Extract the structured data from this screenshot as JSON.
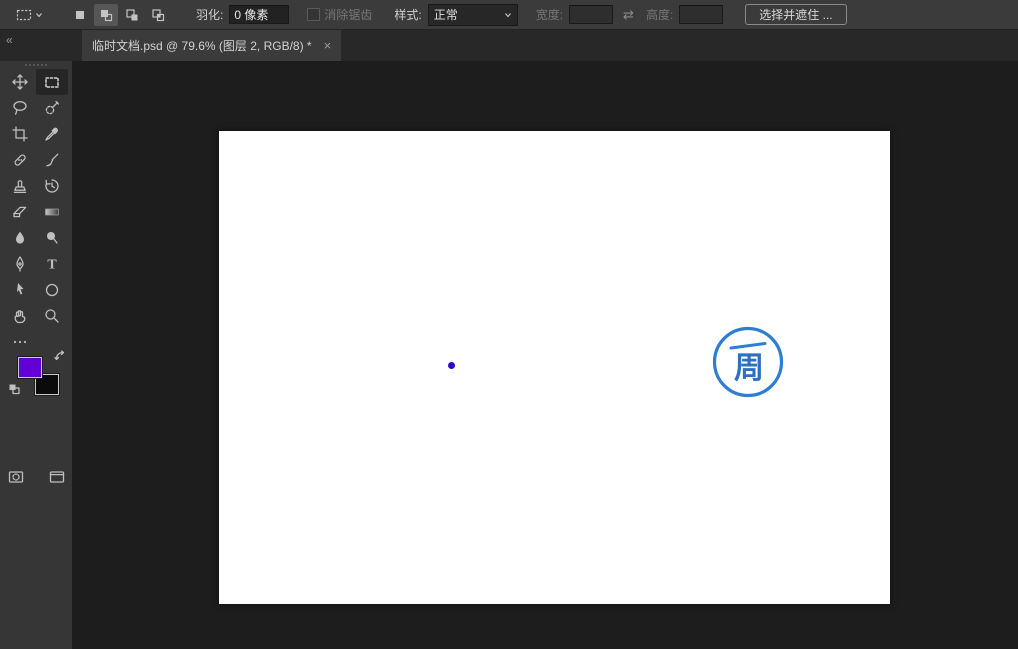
{
  "options_bar": {
    "feather_label": "羽化:",
    "feather_value": "0 像素",
    "antialias_label": "消除锯齿",
    "style_label": "样式:",
    "style_value": "正常",
    "width_label": "宽度:",
    "width_value": "",
    "height_label": "高度:",
    "height_value": "",
    "swap_icon": "⇄",
    "select_and_mask_label": "选择并遮住 ..."
  },
  "tab_bar": {
    "collapse_icon": "«",
    "tab_title": "临时文档.psd @ 79.6% (图层 2, RGB/8) *",
    "close_icon": "×"
  },
  "tools": {
    "selected": "rectangular-marquee",
    "items": [
      "move",
      "rectangular-marquee",
      "lasso",
      "quick-selection",
      "crop",
      "eyedropper",
      "healing-brush",
      "brush",
      "clone-stamp",
      "history-brush",
      "eraser",
      "gradient",
      "blur",
      "dodge",
      "pen",
      "type",
      "path-selection",
      "ellipse-shape",
      "hand",
      "zoom",
      "edit-toolbar-ellipsis",
      "quick-mask",
      "screen-mode"
    ]
  },
  "color_swatches": {
    "foreground": "#6200d6",
    "background": "#0b0b0b"
  },
  "canvas": {
    "document_background": "#ffffff",
    "dot_color": "#2e0ac8",
    "zoom_percent": "79.6%",
    "logo": {
      "char": "周",
      "circle_color": "#2d7dd2",
      "text_color": "#2e6fbe"
    }
  }
}
